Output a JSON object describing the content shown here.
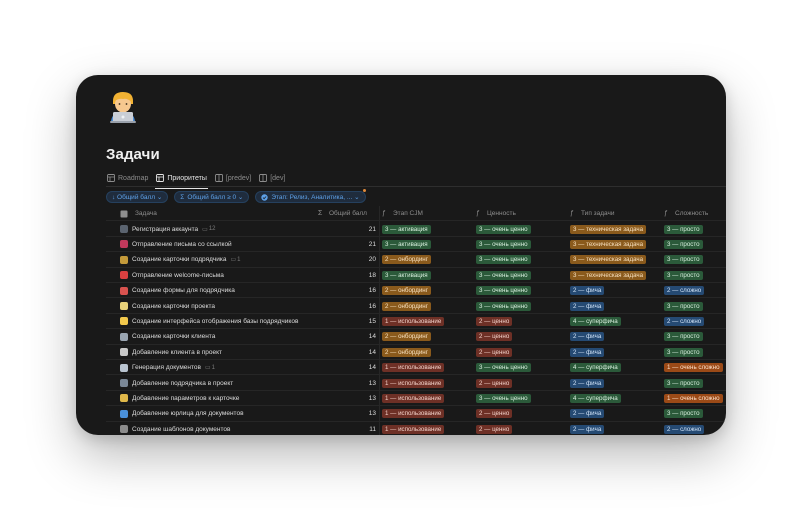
{
  "page": {
    "title": "Задачи",
    "icon": "person-with-laptop-emoji"
  },
  "tabs": [
    {
      "label": "Roadmap",
      "icon": "table-icon",
      "active": false
    },
    {
      "label": "Приоритеты",
      "icon": "table-icon",
      "active": true
    },
    {
      "label": "[predev]",
      "icon": "table-icon",
      "active": false
    },
    {
      "label": "[dev]",
      "icon": "table-icon",
      "active": false
    }
  ],
  "filters": [
    {
      "label": "↓ Общий балл ⌄",
      "icon": "sort-icon"
    },
    {
      "label": "Общий балл ≥ 0 ⌄",
      "icon": "sum-icon"
    },
    {
      "label": "Этап: Релиз, Аналитика, ... ⌄",
      "icon": "status-icon"
    }
  ],
  "columns": {
    "name": "Задача",
    "score": "Общий балл",
    "stage": "Этап CJM",
    "value": "Ценность",
    "type": "Тип задачи",
    "difficulty": "Сложность"
  },
  "colors": {
    "green": "#2b5a3a",
    "orange": "#8a5a1c",
    "red": "#6e3026",
    "blue": "#254a73",
    "redorange": "#9b4a17"
  },
  "rows": [
    {
      "icon": "phone-icon",
      "name": "Регистрация аккаунта",
      "comments": "12",
      "score": "21",
      "stage": {
        "text": "3 — активация",
        "color": "green"
      },
      "value": {
        "text": "3 — очень ценно",
        "color": "green"
      },
      "type": {
        "text": "3 — техническая задача",
        "color": "orange"
      },
      "difficulty": {
        "text": "3 — просто",
        "color": "green"
      }
    },
    {
      "icon": "envelope-icon",
      "name": "Отправление письма со ссылкой",
      "comments": "",
      "score": "21",
      "stage": {
        "text": "3 — активация",
        "color": "green"
      },
      "value": {
        "text": "3 — очень ценно",
        "color": "green"
      },
      "type": {
        "text": "3 — техническая задача",
        "color": "orange"
      },
      "difficulty": {
        "text": "3 — просто",
        "color": "green"
      }
    },
    {
      "icon": "card-icon",
      "name": "Создание карточки подрядчика",
      "comments": "1",
      "score": "20",
      "stage": {
        "text": "2 — онбординг",
        "color": "orange"
      },
      "value": {
        "text": "3 — очень ценно",
        "color": "green"
      },
      "type": {
        "text": "3 — техническая задача",
        "color": "orange"
      },
      "difficulty": {
        "text": "3 — просто",
        "color": "green"
      }
    },
    {
      "icon": "mail-icon",
      "name": "Отправление welcome-письма",
      "comments": "",
      "score": "18",
      "stage": {
        "text": "3 — активация",
        "color": "green"
      },
      "value": {
        "text": "3 — очень ценно",
        "color": "green"
      },
      "type": {
        "text": "3 — техническая задача",
        "color": "orange"
      },
      "difficulty": {
        "text": "3 — просто",
        "color": "green"
      }
    },
    {
      "icon": "phone-call-icon",
      "name": "Создание формы для подрядчика",
      "comments": "",
      "score": "16",
      "stage": {
        "text": "2 — онбординг",
        "color": "orange"
      },
      "value": {
        "text": "3 — очень ценно",
        "color": "green"
      },
      "type": {
        "text": "2 — фича",
        "color": "blue"
      },
      "difficulty": {
        "text": "2 — сложно",
        "color": "blue"
      }
    },
    {
      "icon": "memo-icon",
      "name": "Создание карточки проекта",
      "comments": "",
      "score": "16",
      "stage": {
        "text": "2 — онбординг",
        "color": "orange"
      },
      "value": {
        "text": "3 — очень ценно",
        "color": "green"
      },
      "type": {
        "text": "2 — фича",
        "color": "blue"
      },
      "difficulty": {
        "text": "3 — просто",
        "color": "green"
      }
    },
    {
      "icon": "moon-icon",
      "name": "Создание интерфейса отображения базы подрядчиков",
      "comments": "",
      "score": "15",
      "stage": {
        "text": "1 — использование",
        "color": "red"
      },
      "value": {
        "text": "2 — ценно",
        "color": "red"
      },
      "type": {
        "text": "4 — суперфича",
        "color": "green"
      },
      "difficulty": {
        "text": "2 — сложно",
        "color": "blue"
      }
    },
    {
      "icon": "eye-icon",
      "name": "Создание карточки клиента",
      "comments": "",
      "score": "14",
      "stage": {
        "text": "2 — онбординг",
        "color": "orange"
      },
      "value": {
        "text": "2 — ценно",
        "color": "red"
      },
      "type": {
        "text": "2 — фича",
        "color": "blue"
      },
      "difficulty": {
        "text": "3 — просто",
        "color": "green"
      }
    },
    {
      "icon": "clock-icon",
      "name": "Добавление клиента в проект",
      "comments": "",
      "score": "14",
      "stage": {
        "text": "2 — онбординг",
        "color": "orange"
      },
      "value": {
        "text": "2 — ценно",
        "color": "red"
      },
      "type": {
        "text": "2 — фича",
        "color": "blue"
      },
      "difficulty": {
        "text": "3 — просто",
        "color": "green"
      }
    },
    {
      "icon": "document-icon",
      "name": "Генерация документов",
      "comments": "1",
      "score": "14",
      "stage": {
        "text": "1 — использование",
        "color": "red"
      },
      "value": {
        "text": "3 — очень ценно",
        "color": "green"
      },
      "type": {
        "text": "4 — суперфича",
        "color": "green"
      },
      "difficulty": {
        "text": "1 — очень сложно",
        "color": "redorange"
      }
    },
    {
      "icon": "mobile-icon",
      "name": "Добавление подрядчика в проект",
      "comments": "",
      "score": "13",
      "stage": {
        "text": "1 — использование",
        "color": "red"
      },
      "value": {
        "text": "2 — ценно",
        "color": "red"
      },
      "type": {
        "text": "2 — фича",
        "color": "blue"
      },
      "difficulty": {
        "text": "3 — просто",
        "color": "green"
      }
    },
    {
      "icon": "magic-wand-icon",
      "name": "Добавление параметров к карточке",
      "comments": "",
      "score": "13",
      "stage": {
        "text": "1 — использование",
        "color": "red"
      },
      "value": {
        "text": "3 — очень ценно",
        "color": "green"
      },
      "type": {
        "text": "4 — суперфича",
        "color": "green"
      },
      "difficulty": {
        "text": "1 — очень сложно",
        "color": "redorange"
      }
    },
    {
      "icon": "globe-icon",
      "name": "Добавление юрлица для документов",
      "comments": "",
      "score": "13",
      "stage": {
        "text": "1 — использование",
        "color": "red"
      },
      "value": {
        "text": "2 — ценно",
        "color": "red"
      },
      "type": {
        "text": "2 — фича",
        "color": "blue"
      },
      "difficulty": {
        "text": "3 — просто",
        "color": "green"
      }
    },
    {
      "icon": "keyboard-icon",
      "name": "Создание шаблонов документов",
      "comments": "",
      "score": "11",
      "stage": {
        "text": "1 — использование",
        "color": "red"
      },
      "value": {
        "text": "2 — ценно",
        "color": "red"
      },
      "type": {
        "text": "2 — фича",
        "color": "blue"
      },
      "difficulty": {
        "text": "2 — сложно",
        "color": "blue"
      }
    }
  ]
}
